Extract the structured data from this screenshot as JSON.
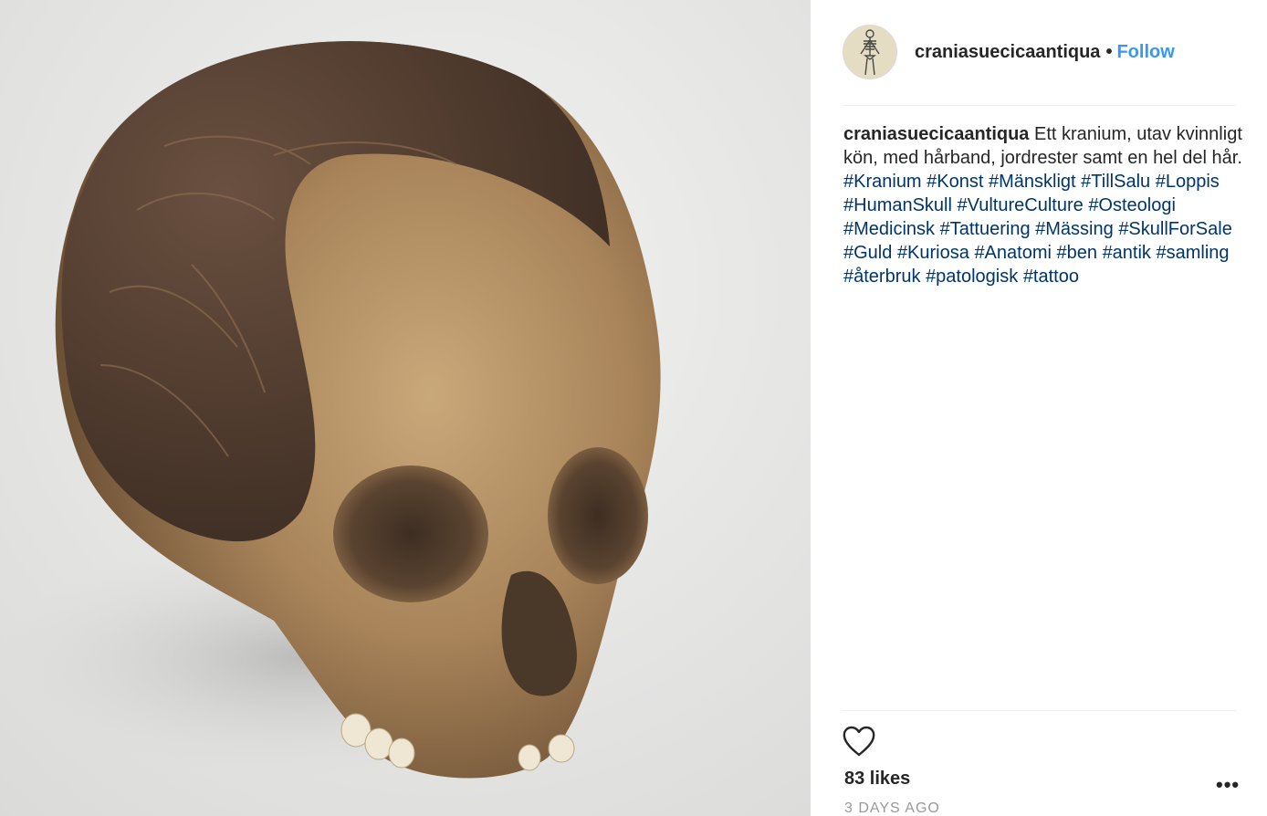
{
  "post": {
    "username": "craniasuecicaantiqua",
    "separator": "•",
    "follow_label": "Follow",
    "caption": {
      "username": "craniasuecicaantiqua",
      "text": "Ett kranium, utav kvinnligt kön, med hårband, jordrester samt en hel del hår.",
      "hashtags": [
        "#Kranium",
        "#Konst",
        "#Mänskligt",
        "#TillSalu",
        "#Loppis",
        "#HumanSkull",
        "#VultureCulture",
        "#Osteologi",
        "#Medicinsk",
        "#Tattuering",
        "#Mässing",
        "#SkullForSale",
        "#Guld",
        "#Kuriosa",
        "#Anatomi",
        "#ben",
        "#antik",
        "#samling",
        "#återbruk",
        "#patologisk",
        "#tattoo"
      ]
    },
    "likes": "83 likes",
    "timestamp": "3 DAYS AGO",
    "more_label": "•••",
    "icons": {
      "like": "heart-outline-icon",
      "more": "more-horizontal-icon",
      "avatar": "skeleton-illustration"
    },
    "colors": {
      "follow": "#3897f0",
      "hashtag": "#003569",
      "text": "#262626",
      "muted": "#999999",
      "photo_background": "#ebebea"
    }
  }
}
